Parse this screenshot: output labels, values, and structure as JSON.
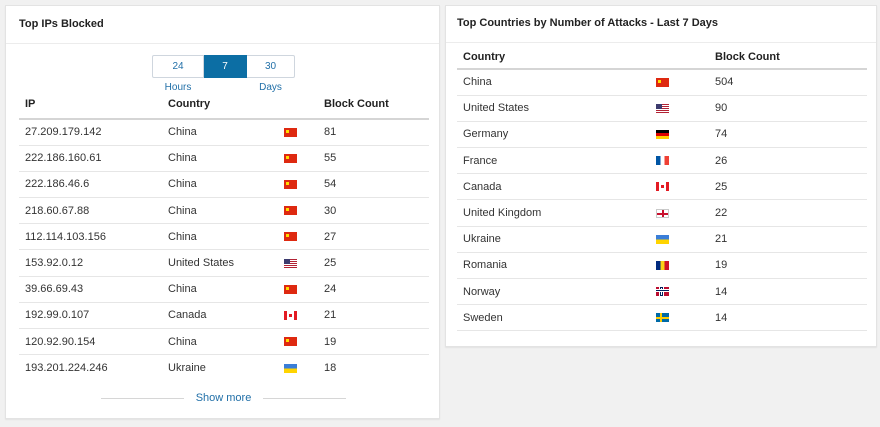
{
  "top_ips": {
    "title": "Top IPs Blocked",
    "range_buttons": [
      "24 Hours",
      "7 Days",
      "30 Days"
    ],
    "active_range": "7 Days",
    "columns": [
      "IP",
      "Country",
      "Block Count"
    ],
    "rows": [
      {
        "ip": "27.209.179.142",
        "country": "China",
        "flag": "china",
        "count": "81"
      },
      {
        "ip": "222.186.160.61",
        "country": "China",
        "flag": "china",
        "count": "55"
      },
      {
        "ip": "222.186.46.6",
        "country": "China",
        "flag": "china",
        "count": "54"
      },
      {
        "ip": "218.60.67.88",
        "country": "China",
        "flag": "china",
        "count": "30"
      },
      {
        "ip": "112.114.103.156",
        "country": "China",
        "flag": "china",
        "count": "27"
      },
      {
        "ip": "153.92.0.12",
        "country": "United States",
        "flag": "us",
        "count": "25"
      },
      {
        "ip": "39.66.69.43",
        "country": "China",
        "flag": "china",
        "count": "24"
      },
      {
        "ip": "192.99.0.107",
        "country": "Canada",
        "flag": "canada",
        "count": "21"
      },
      {
        "ip": "120.92.90.154",
        "country": "China",
        "flag": "china",
        "count": "19"
      },
      {
        "ip": "193.201.224.246",
        "country": "Ukraine",
        "flag": "ukraine",
        "count": "18"
      }
    ],
    "show_more": "Show more"
  },
  "top_countries": {
    "title": "Top Countries by Number of Attacks - Last 7 Days",
    "columns": [
      "Country",
      "Block Count"
    ],
    "rows": [
      {
        "country": "China",
        "flag": "china",
        "count": "504"
      },
      {
        "country": "United States",
        "flag": "us",
        "count": "90"
      },
      {
        "country": "Germany",
        "flag": "germany",
        "count": "74"
      },
      {
        "country": "France",
        "flag": "france",
        "count": "26"
      },
      {
        "country": "Canada",
        "flag": "canada",
        "count": "25"
      },
      {
        "country": "United Kingdom",
        "flag": "uk",
        "count": "22"
      },
      {
        "country": "Ukraine",
        "flag": "ukraine",
        "count": "21"
      },
      {
        "country": "Romania",
        "flag": "romania",
        "count": "19"
      },
      {
        "country": "Norway",
        "flag": "norway",
        "count": "14"
      },
      {
        "country": "Sweden",
        "flag": "sweden",
        "count": "14"
      }
    ]
  }
}
